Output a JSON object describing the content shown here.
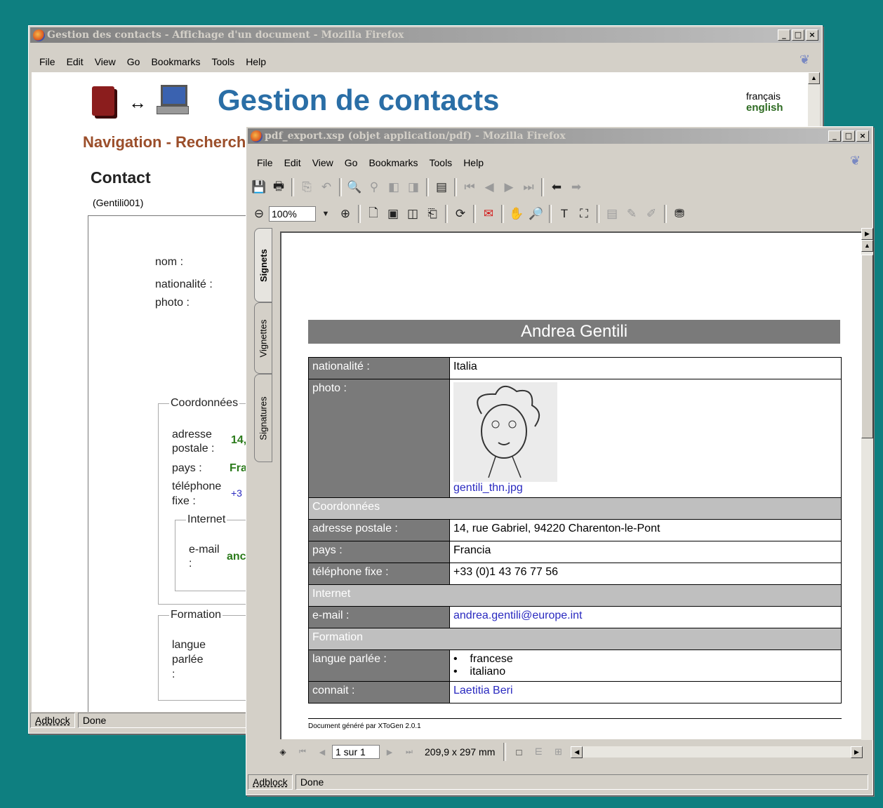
{
  "win1": {
    "title": "Gestion des contacts - Affichage d'un document - Mozilla Firefox",
    "menus": [
      "File",
      "Edit",
      "View",
      "Go",
      "Bookmarks",
      "Tools",
      "Help"
    ],
    "app_title": "Gestion de contacts",
    "lang_fr": "français",
    "lang_en": "english",
    "nav": "Navigation - Recherch",
    "contact_heading": "Contact",
    "contact_id": "(Gentili001)",
    "labels": {
      "nom": "nom :",
      "nationalite": "nationalité :",
      "photo": "photo :",
      "coordonnees": "Coordonnées",
      "adresse": "adresse",
      "postale": "postale :",
      "adresse_val": "14,",
      "pays": "pays :",
      "pays_val": "Fra",
      "telephone": "téléphone",
      "fixe": "fixe :",
      "telephone_val": "+3",
      "internet": "Internet",
      "email": "e-mail",
      "email_colon": ":",
      "email_val": "anc",
      "formation": "Formation",
      "langue": "langue",
      "parlee": "parlée",
      "langue_colon": ":"
    },
    "status": {
      "adblock": "Adblock",
      "text": "Done"
    }
  },
  "win2": {
    "title": "pdf_export.xsp (objet application/pdf) - Mozilla Firefox",
    "menus": [
      "File",
      "Edit",
      "View",
      "Go",
      "Bookmarks",
      "Tools",
      "Help"
    ],
    "zoom": "100%",
    "side_tabs": [
      "Signets",
      "Vignettes",
      "Signatures"
    ],
    "pdf": {
      "name": "Andrea Gentili",
      "rows": [
        {
          "k": "nationalité :",
          "v": "Italia"
        },
        {
          "k": "photo :",
          "v": "gentili_thn.jpg"
        }
      ],
      "sec_coord": "Coordonnées",
      "adresse_k": "adresse postale :",
      "adresse_v": "14, rue Gabriel, 94220 Charenton-le-Pont",
      "pays_k": "pays :",
      "pays_v": "Francia",
      "tel_k": "téléphone fixe :",
      "tel_v": "+33 (0)1 43 76 77 56",
      "sec_internet": "Internet",
      "email_k": "e-mail :",
      "email_v": "andrea.gentili@europe.int",
      "sec_formation": "Formation",
      "langue_k": "langue parlée :",
      "langues": [
        "francese",
        "italiano"
      ],
      "connait_k": "connait :",
      "connait_v": "Laetitia Beri",
      "footer": "Document généré par XToGen 2.0.1"
    },
    "page_nav": "1 sur 1",
    "page_size": "209,9 x 297 mm",
    "status": {
      "adblock": "Adblock",
      "text": "Done"
    }
  }
}
